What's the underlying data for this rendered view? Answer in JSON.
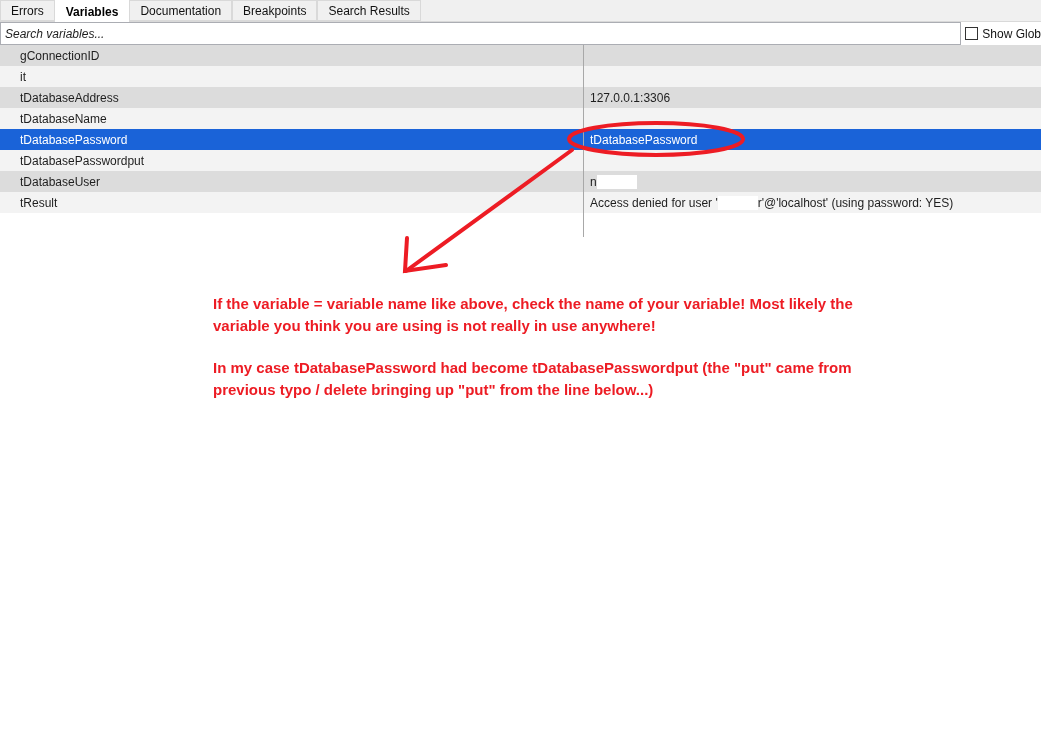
{
  "tabs": [
    {
      "label": "Errors",
      "selected": false
    },
    {
      "label": "Variables",
      "selected": true
    },
    {
      "label": "Documentation",
      "selected": false
    },
    {
      "label": "Breakpoints",
      "selected": false
    },
    {
      "label": "Search Results",
      "selected": false
    }
  ],
  "search": {
    "placeholder": "Search variables..."
  },
  "show_globals": {
    "label": "Show Glob",
    "checked": false
  },
  "variables": [
    {
      "name": "gConnectionID",
      "selected": false
    },
    {
      "name": "it",
      "selected": false
    },
    {
      "name": "tDatabaseAddress",
      "selected": false,
      "value": [
        {
          "kind": "text",
          "text": "127.0.0.1:3306"
        }
      ]
    },
    {
      "name": "tDatabaseName",
      "selected": false
    },
    {
      "name": "tDatabasePassword",
      "selected": true,
      "value": [
        {
          "kind": "text",
          "text": "tDatabasePassword"
        }
      ]
    },
    {
      "name": "tDatabasePasswordput",
      "selected": false
    },
    {
      "name": "tDatabaseUser",
      "selected": false,
      "value": [
        {
          "kind": "text",
          "text": "n"
        },
        {
          "kind": "redacted"
        }
      ]
    },
    {
      "name": "tResult",
      "selected": false,
      "value": [
        {
          "kind": "text",
          "text": "Access denied for user '"
        },
        {
          "kind": "redacted"
        },
        {
          "kind": "text",
          "text": "r'@'localhost' (using password: YES)"
        }
      ]
    }
  ],
  "annotation": {
    "paragraphs": [
      "If the variable = variable name like above, check the name of your variable! Most likely the\nvariable you think you are using is not really in use anywhere!",
      "In my case tDatabasePassword had become tDatabasePasswordput (the \"put\" came from\nprevious typo / delete bringing up \"put\" from the line below...)"
    ]
  }
}
